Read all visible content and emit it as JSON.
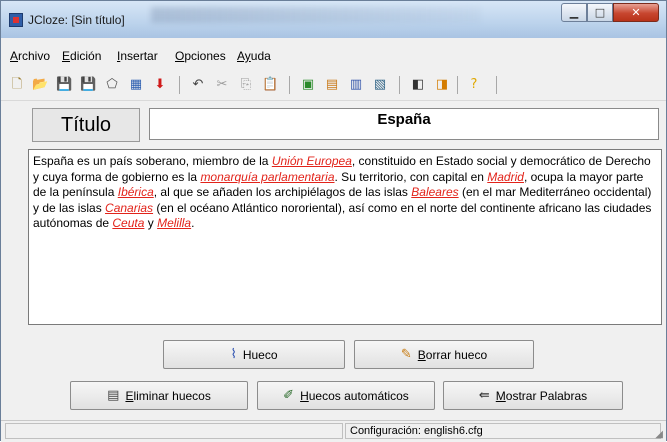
{
  "window": {
    "title": "JCloze: [Sin título]",
    "min_glyph": "▁",
    "max_glyph": "□",
    "close_glyph": "✕"
  },
  "menu": [
    {
      "first": "A",
      "rest": "rchivo"
    },
    {
      "first": "E",
      "rest": "dición"
    },
    {
      "first": "I",
      "rest": "nsertar"
    },
    {
      "first": "O",
      "rest": "pciones"
    },
    {
      "first": "Ay",
      "rest": "uda"
    }
  ],
  "toolbar": {
    "icons": [
      {
        "name": "new-file-icon",
        "glyph": "🗋",
        "color": "#9a7b2c"
      },
      {
        "name": "open-folder-icon",
        "glyph": "📂",
        "color": "#c99b2a"
      },
      {
        "name": "save-icon",
        "glyph": "💾",
        "color": "#1f2f7a"
      },
      {
        "name": "save-as-icon",
        "glyph": "💾",
        "color": "#1f2f7a"
      },
      {
        "name": "eraser-icon",
        "glyph": "⬠",
        "color": "#555555"
      },
      {
        "name": "gap-grid-icon",
        "glyph": "▦",
        "color": "#2a5db0"
      },
      {
        "name": "arrow-down-icon",
        "glyph": "⬇",
        "color": "#d01a1a"
      },
      {
        "name": "undo-icon",
        "glyph": "↶",
        "color": "#444444"
      },
      {
        "name": "cut-icon",
        "glyph": "✂",
        "color": "#9a9a9a"
      },
      {
        "name": "copy-icon",
        "glyph": "⎘",
        "color": "#9a9a9a"
      },
      {
        "name": "paste-icon",
        "glyph": "📋",
        "color": "#777777"
      },
      {
        "name": "html-export-icon",
        "glyph": "▣",
        "color": "#2a8a2a"
      },
      {
        "name": "html-export-alt-icon",
        "glyph": "▤",
        "color": "#c97a1a"
      },
      {
        "name": "gap-auto-icon",
        "glyph": "▥",
        "color": "#3355aa"
      },
      {
        "name": "gap-words-icon",
        "glyph": "▧",
        "color": "#336688"
      },
      {
        "name": "tile-windows-icon",
        "glyph": "◧",
        "color": "#333333"
      },
      {
        "name": "config-icon",
        "glyph": "◨",
        "color": "#d47c00"
      },
      {
        "name": "help-icon",
        "glyph": "?",
        "color": "#e0a800"
      }
    ]
  },
  "title_label": "Título",
  "title_value": "España",
  "content": {
    "t1": "España es un país soberano, miembro de la ",
    "g1": "Unión Europea",
    "t2": ", constituido en Estado social y democrático de Derecho y cuya forma de gobierno es la ",
    "g2": "monarquía parlamentaria",
    "t3": ". Su territorio, con capital en ",
    "g3": "Madrid",
    "t4": ", ocupa la mayor parte de la península ",
    "g4": "Ibérica",
    "t5": ", al que se añaden los archipiélagos de las islas ",
    "g5": "Baleares",
    "t6": " (en el mar Mediterráneo occidental) y de las islas ",
    "g6": "Canarias",
    "t7": " (en el océano Atlántico nororiental), así como en el norte del continente africano las ciudades autónomas de ",
    "g7": "Ceuta",
    "t8": " y ",
    "g8": "Melilla",
    "t9": "."
  },
  "buttons": {
    "hueco": {
      "icon": "⌇",
      "label": "Hueco"
    },
    "borrar": {
      "icon": "✎",
      "first": "B",
      "rest": "orrar hueco"
    },
    "eliminar": {
      "icon": "▤",
      "first": "E",
      "rest": "liminar huecos"
    },
    "auto": {
      "icon": "✐",
      "first": "H",
      "rest": "uecos automáticos"
    },
    "mostrar": {
      "icon": "⇚",
      "first": "M",
      "rest": "ostrar Palabras"
    }
  },
  "status": {
    "config": "Configuración: english6.cfg",
    "grip": "◢"
  },
  "colors": {
    "gap": "#e2231a",
    "close_button": "#c7462f"
  }
}
